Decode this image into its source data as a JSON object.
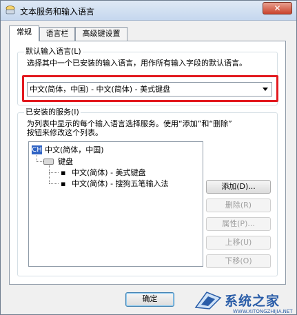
{
  "window": {
    "title": "文本服务和输入语言",
    "close_label": "✕"
  },
  "tabs": [
    {
      "label": "常规"
    },
    {
      "label": "语言栏"
    },
    {
      "label": "高级键设置"
    }
  ],
  "default_language": {
    "group_title": "默认输入语言(L)",
    "description": "选择其中一个已安装的输入语言，用作所有输入字段的默认语言。",
    "selected_value": "中文(简体，中国) - 中文(简体) - 美式键盘",
    "highlight_color": "#e2191f"
  },
  "installed_services": {
    "group_title": "已安装的服务(I)",
    "description_line1": "为列表中显示的每个输入语言选择服务。使用“添加”和“删除”",
    "description_line2": "按钮来修改这个列表。",
    "tree": {
      "language_badge": "CH",
      "language_label": "中文(简体，中国)",
      "keyboard_label": "键盘",
      "items": [
        "中文(简体) - 美式键盘",
        "中文(简体) - 搜狗五笔输入法"
      ]
    },
    "buttons": {
      "add": "添加(D)...",
      "remove": "删除(R)",
      "properties": "属性(P)...",
      "move_up": "上移(U)",
      "move_down": "下移(O)"
    }
  },
  "footer": {
    "ok_label": "确定"
  },
  "watermark": {
    "text": "系统之家",
    "url": "WWW.XITONGZHIJIA.NET"
  }
}
